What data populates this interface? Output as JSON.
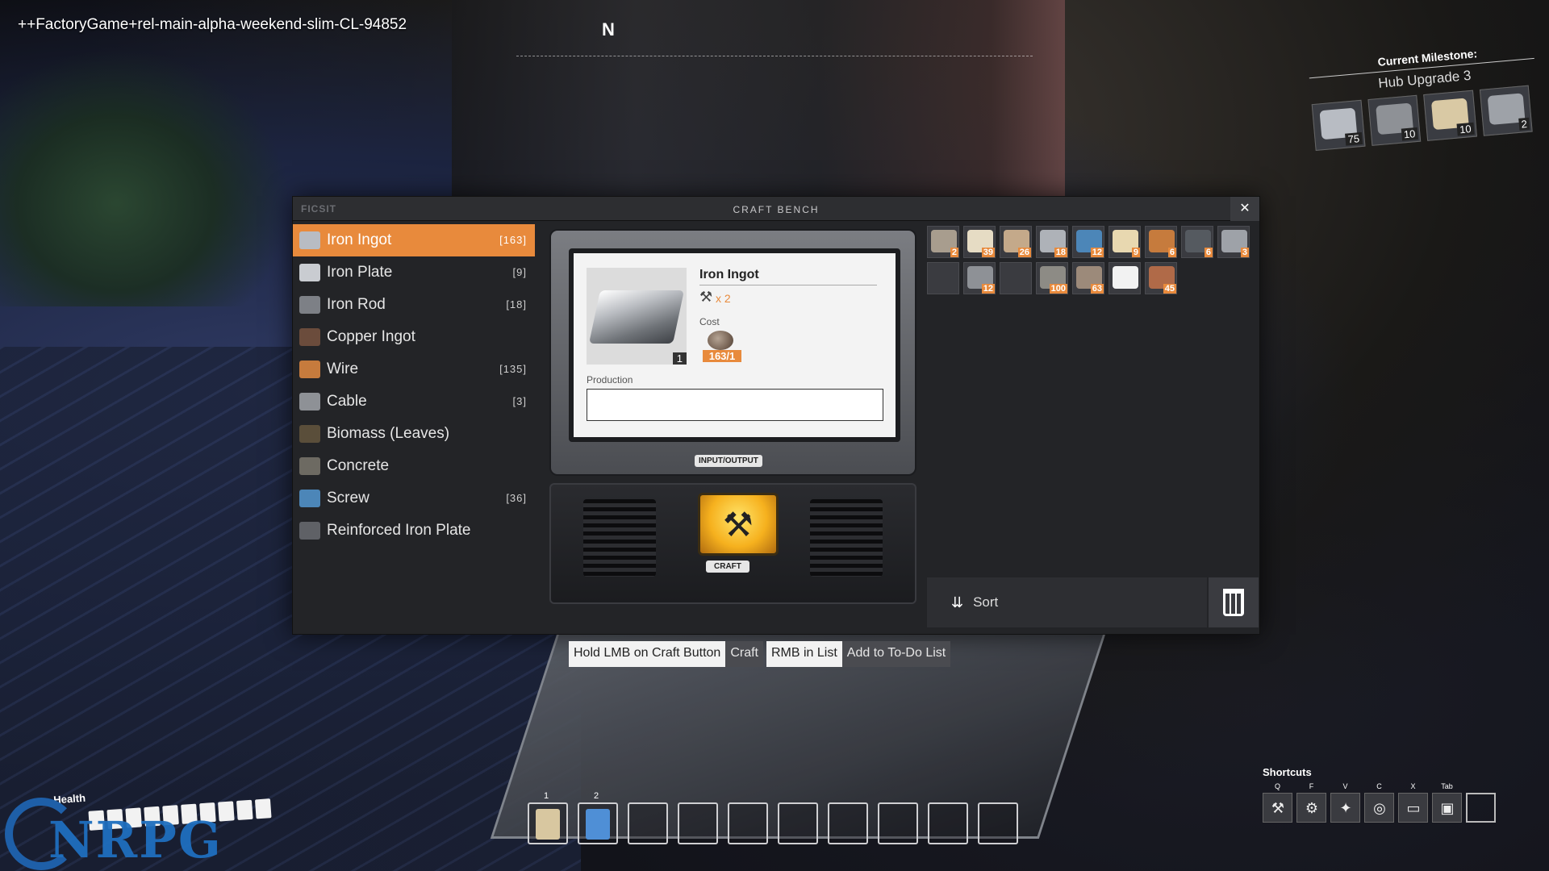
{
  "hud": {
    "build_tag": "++FactoryGame+rel-main-alpha-weekend-slim-CL-94852",
    "compass": "N",
    "milestone": {
      "label": "Current Milestone:",
      "title": "Hub Upgrade 3",
      "items": [
        {
          "icon": "iron-plate-icon",
          "count": "75",
          "color": "#b8bcc3"
        },
        {
          "icon": "cable-icon",
          "count": "10",
          "color": "#8e9196"
        },
        {
          "icon": "concrete-icon",
          "count": "10",
          "color": "#d9c9a4"
        },
        {
          "icon": "reinforced-plate-icon",
          "count": "2",
          "color": "#9ea2a8"
        }
      ]
    }
  },
  "window": {
    "logo": "FICSIT",
    "title": "CRAFT BENCH",
    "close": "✕"
  },
  "recipes": [
    {
      "name": "Iron Ingot",
      "count": "[163]",
      "selected": true,
      "icon": "iron-ingot-icon",
      "color": "#b8bcc3"
    },
    {
      "name": "Iron Plate",
      "count": "[9]",
      "icon": "iron-plate-icon",
      "color": "#c9ccd1"
    },
    {
      "name": "Iron Rod",
      "count": "[18]",
      "icon": "iron-rod-icon",
      "color": "#7d8086"
    },
    {
      "name": "Copper Ingot",
      "count": "",
      "icon": "copper-ingot-icon",
      "color": "#6b4c3c"
    },
    {
      "name": "Wire",
      "count": "[135]",
      "icon": "wire-icon",
      "color": "#c67b3d"
    },
    {
      "name": "Cable",
      "count": "[3]",
      "icon": "cable-icon",
      "color": "#8e9196"
    },
    {
      "name": "Biomass (Leaves)",
      "count": "",
      "icon": "biomass-icon",
      "color": "#5a4e3a"
    },
    {
      "name": "Concrete",
      "count": "",
      "icon": "concrete-icon",
      "color": "#6d6a62"
    },
    {
      "name": "Screw",
      "count": "[36]",
      "icon": "screw-icon",
      "color": "#4c86b8"
    },
    {
      "name": "Reinforced Iron Plate",
      "count": "",
      "icon": "reinforced-plate-icon",
      "color": "#5f6166"
    }
  ],
  "detail": {
    "item_name": "Iron Ingot",
    "item_qty": "1",
    "hammer": "⚒",
    "yield": "x 2",
    "cost_label": "Cost",
    "cost_value": "163/1",
    "production_label": "Production",
    "io_tag": "INPUT/OUTPUT",
    "craft_tag": "CRAFT",
    "craft_icon": "⚒"
  },
  "inventory": {
    "slots": [
      {
        "icon": "iron-ore-icon",
        "count": "2",
        "color": "#a89d8e"
      },
      {
        "icon": "limestone-icon",
        "count": "39",
        "color": "#e6dcc4"
      },
      {
        "icon": "copper-ore-icon",
        "count": "26",
        "color": "#c4a98a"
      },
      {
        "icon": "iron-plate-icon",
        "count": "18",
        "color": "#aeb2b8"
      },
      {
        "icon": "screw-icon",
        "count": "12",
        "color": "#4c86b8"
      },
      {
        "icon": "cable-coil-icon",
        "count": "9",
        "color": "#e8d8b0"
      },
      {
        "icon": "wire-spool-icon",
        "count": "6",
        "color": "#c67b3d"
      },
      {
        "icon": "iron-rod-icon",
        "count": "6",
        "color": "#555a60"
      },
      {
        "icon": "steel-plate-icon",
        "count": "3",
        "color": "#9ea2a8"
      },
      {
        "icon": "empty-slot",
        "count": "",
        "color": "#3a3b40"
      },
      {
        "icon": "cable-icon",
        "count": "12",
        "color": "#8e9196"
      },
      {
        "icon": "empty-slot",
        "count": "",
        "color": "#3a3b40"
      },
      {
        "icon": "stone-icon",
        "count": "100",
        "color": "#8d8b85"
      },
      {
        "icon": "ore-chunk-icon",
        "count": "63",
        "color": "#9c8a7a"
      },
      {
        "icon": "wrench-icon",
        "count": "",
        "color": "#f2f2f2"
      },
      {
        "icon": "copper-sheet-icon",
        "count": "45",
        "color": "#b06a48"
      }
    ],
    "sort_icon": "⇊",
    "sort_label": "Sort"
  },
  "hints": [
    {
      "key": "Hold LMB on Craft Button",
      "action": "Craft"
    },
    {
      "key": "RMB in List",
      "action": "Add to To-Do List"
    }
  ],
  "health": {
    "label": "Health",
    "segments": 10
  },
  "watermark": "NRPG",
  "hotbar": [
    {
      "num": "1",
      "icon": "xeno-zapper-icon",
      "color": "#d8c7a0"
    },
    {
      "num": "2",
      "icon": "scanner-icon",
      "color": "#4f8fd6"
    },
    {
      "num": "",
      "icon": "",
      "color": ""
    },
    {
      "num": "",
      "icon": "",
      "color": ""
    },
    {
      "num": "",
      "icon": "",
      "color": ""
    },
    {
      "num": "",
      "icon": "",
      "color": ""
    },
    {
      "num": "",
      "icon": "",
      "color": ""
    },
    {
      "num": "",
      "icon": "",
      "color": ""
    },
    {
      "num": "",
      "icon": "",
      "color": ""
    },
    {
      "num": "",
      "icon": "",
      "color": ""
    }
  ],
  "shortcuts": {
    "label": "Shortcuts",
    "items": [
      {
        "key": "Q",
        "icon": "build-gun-icon",
        "glyph": "⚒"
      },
      {
        "key": "F",
        "icon": "dismantle-icon",
        "glyph": "⚙"
      },
      {
        "key": "V",
        "icon": "flashlight-icon",
        "glyph": "✦"
      },
      {
        "key": "C",
        "icon": "scanner-icon",
        "glyph": "◎"
      },
      {
        "key": "X",
        "icon": "codex-icon",
        "glyph": "▭"
      },
      {
        "key": "Tab",
        "icon": "inventory-icon",
        "glyph": "▣"
      },
      {
        "key": "",
        "icon": "empty-slot",
        "glyph": ""
      }
    ]
  }
}
